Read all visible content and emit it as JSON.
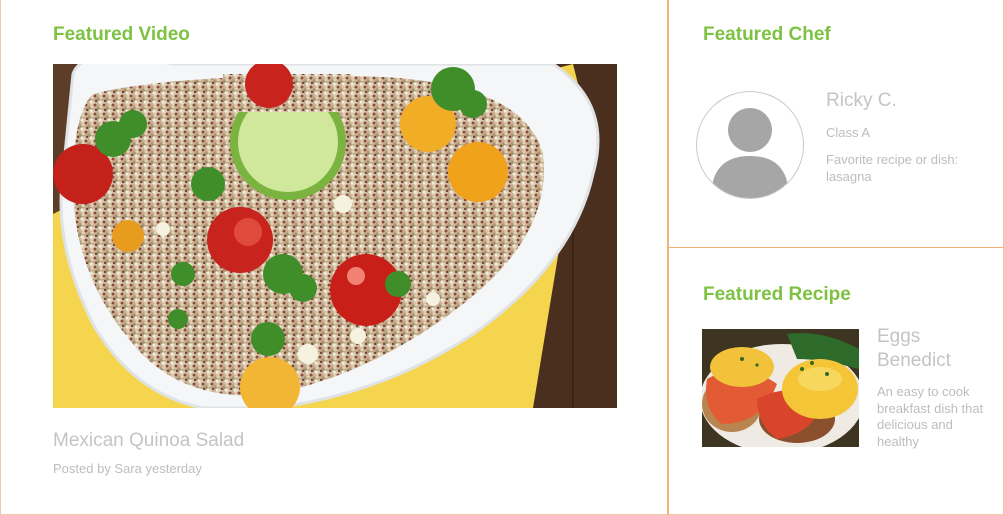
{
  "featured_video": {
    "heading": "Featured Video",
    "image_name": "quinoa-salad-photo",
    "caption": "Mexican Quinoa Salad",
    "meta": "Posted by Sara yesterday"
  },
  "featured_chef": {
    "heading": "Featured Chef",
    "avatar_icon": "user-avatar-icon",
    "name": "Ricky C.",
    "class": "Class A",
    "favorite": "Favorite recipe or dish: lasagna"
  },
  "featured_recipe": {
    "heading": "Featured Recipe",
    "image_name": "eggs-benedict-photo",
    "name": "Eggs Benedict",
    "description": "An easy to cook breakfast dish that delicious and healthy"
  },
  "colors": {
    "accent_green": "#7dc242",
    "divider_orange": "#f2b27a",
    "muted_text": "#c4c4c4"
  }
}
